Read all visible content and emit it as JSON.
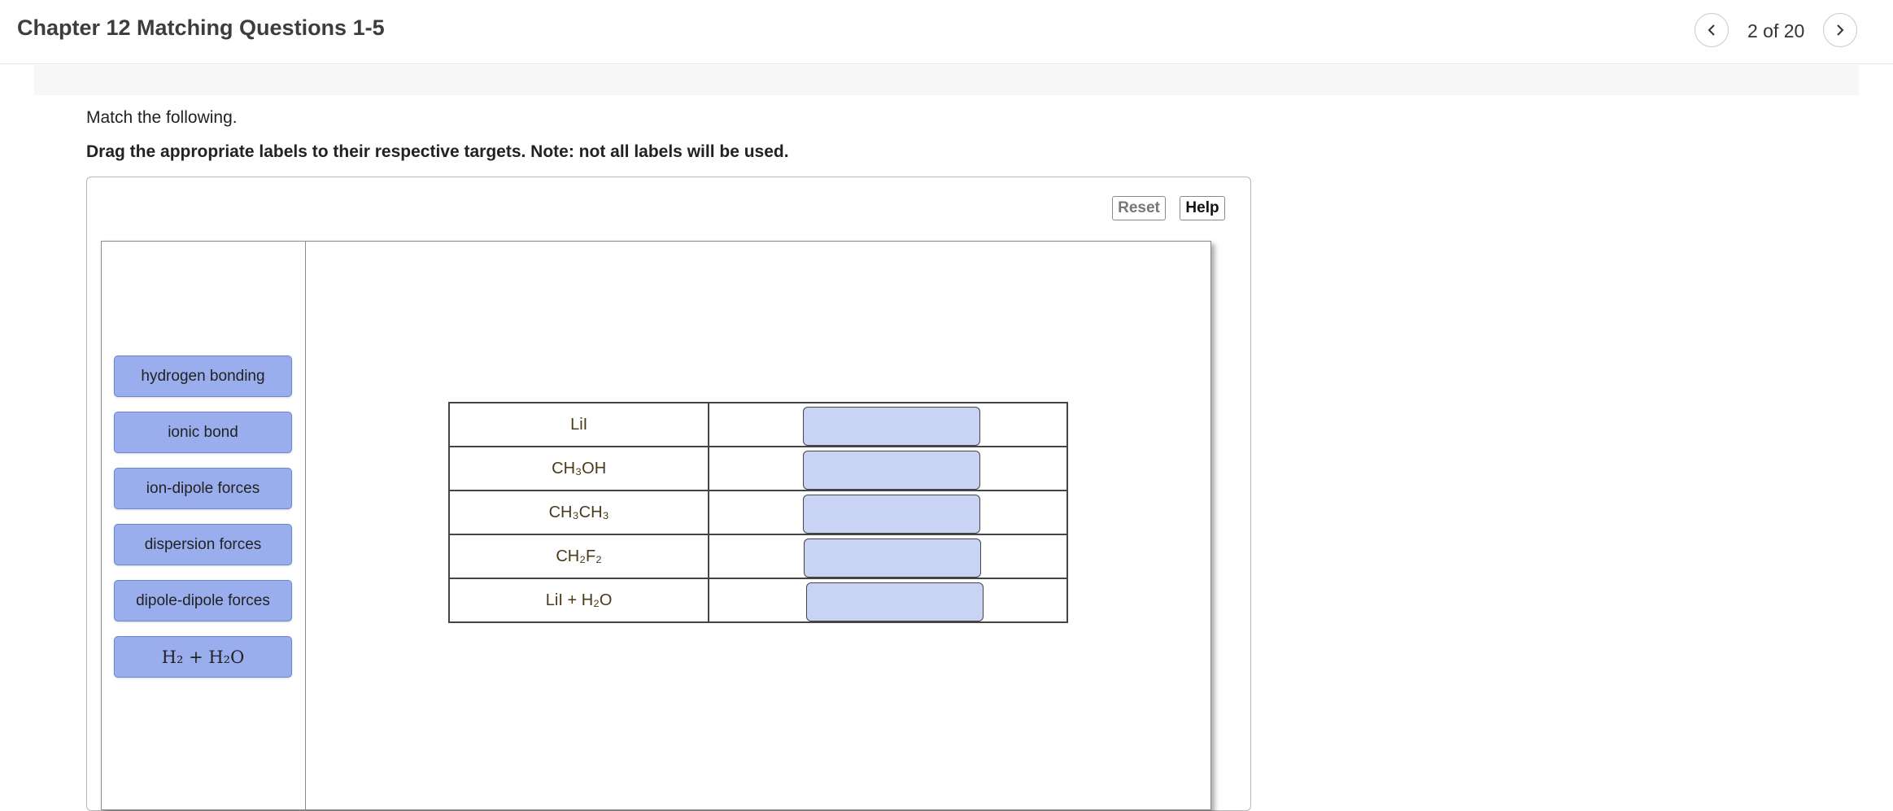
{
  "header": {
    "title": "Chapter 12 Matching Questions 1-5",
    "page_indicator": "2 of 20",
    "prev_icon": "chevron-left-icon",
    "next_icon": "chevron-right-icon"
  },
  "instructions": {
    "line1": "Match the following.",
    "line2": "Drag the appropriate labels to their respective targets. Note: not all labels will be used."
  },
  "toolbar": {
    "reset_label": "Reset",
    "help_label": "Help"
  },
  "labels": [
    {
      "text": "hydrogen bonding"
    },
    {
      "text": "ionic bond"
    },
    {
      "text": "ion-dipole forces"
    },
    {
      "text": "dispersion forces"
    },
    {
      "text": "dipole-dipole forces"
    },
    {
      "text": "H₂ + H₂O"
    }
  ],
  "rows": [
    {
      "compound": "LiI",
      "target": ""
    },
    {
      "compound": "CH₃OH",
      "target": ""
    },
    {
      "compound": "CH₃CH₃",
      "target": ""
    },
    {
      "compound": "CH₂F₂",
      "target": ""
    },
    {
      "compound": "LiI + H₂O",
      "target": ""
    }
  ],
  "colors": {
    "label_fill": "#9aaeee",
    "target_fill": "#c9d3f4"
  }
}
